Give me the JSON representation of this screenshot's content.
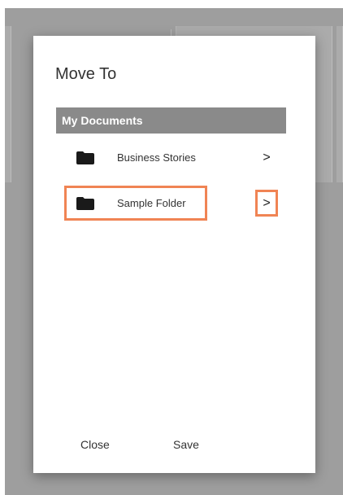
{
  "dialog": {
    "title": "Move To",
    "header": "My Documents",
    "items": [
      {
        "label": "Business Stories",
        "icon": "folder-icon",
        "chevron": ">"
      },
      {
        "label": "Sample Folder",
        "icon": "folder-icon",
        "chevron": ">"
      }
    ],
    "close_label": "Close",
    "save_label": "Save"
  },
  "colors": {
    "header_bg": "#8a8a8a",
    "highlight": "#f08454",
    "overlay": "#9e9e9e"
  }
}
